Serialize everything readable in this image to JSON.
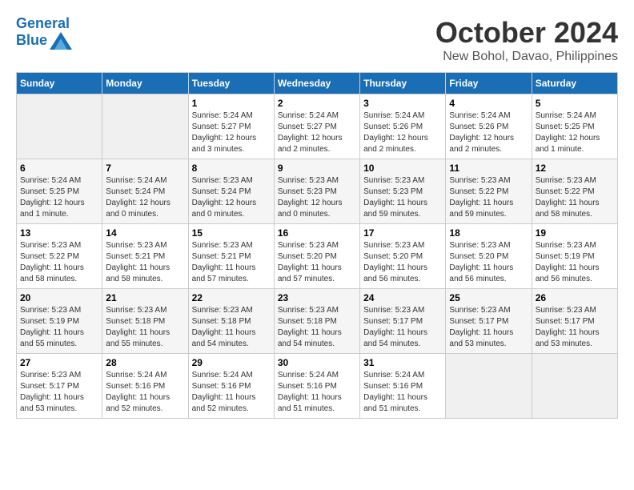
{
  "header": {
    "logo_line1": "General",
    "logo_line2": "Blue",
    "month": "October 2024",
    "location": "New Bohol, Davao, Philippines"
  },
  "weekdays": [
    "Sunday",
    "Monday",
    "Tuesday",
    "Wednesday",
    "Thursday",
    "Friday",
    "Saturday"
  ],
  "weeks": [
    [
      {
        "day": "",
        "info": ""
      },
      {
        "day": "",
        "info": ""
      },
      {
        "day": "1",
        "info": "Sunrise: 5:24 AM\nSunset: 5:27 PM\nDaylight: 12 hours\nand 3 minutes."
      },
      {
        "day": "2",
        "info": "Sunrise: 5:24 AM\nSunset: 5:27 PM\nDaylight: 12 hours\nand 2 minutes."
      },
      {
        "day": "3",
        "info": "Sunrise: 5:24 AM\nSunset: 5:26 PM\nDaylight: 12 hours\nand 2 minutes."
      },
      {
        "day": "4",
        "info": "Sunrise: 5:24 AM\nSunset: 5:26 PM\nDaylight: 12 hours\nand 2 minutes."
      },
      {
        "day": "5",
        "info": "Sunrise: 5:24 AM\nSunset: 5:25 PM\nDaylight: 12 hours\nand 1 minute."
      }
    ],
    [
      {
        "day": "6",
        "info": "Sunrise: 5:24 AM\nSunset: 5:25 PM\nDaylight: 12 hours\nand 1 minute."
      },
      {
        "day": "7",
        "info": "Sunrise: 5:24 AM\nSunset: 5:24 PM\nDaylight: 12 hours\nand 0 minutes."
      },
      {
        "day": "8",
        "info": "Sunrise: 5:23 AM\nSunset: 5:24 PM\nDaylight: 12 hours\nand 0 minutes."
      },
      {
        "day": "9",
        "info": "Sunrise: 5:23 AM\nSunset: 5:23 PM\nDaylight: 12 hours\nand 0 minutes."
      },
      {
        "day": "10",
        "info": "Sunrise: 5:23 AM\nSunset: 5:23 PM\nDaylight: 11 hours\nand 59 minutes."
      },
      {
        "day": "11",
        "info": "Sunrise: 5:23 AM\nSunset: 5:22 PM\nDaylight: 11 hours\nand 59 minutes."
      },
      {
        "day": "12",
        "info": "Sunrise: 5:23 AM\nSunset: 5:22 PM\nDaylight: 11 hours\nand 58 minutes."
      }
    ],
    [
      {
        "day": "13",
        "info": "Sunrise: 5:23 AM\nSunset: 5:22 PM\nDaylight: 11 hours\nand 58 minutes."
      },
      {
        "day": "14",
        "info": "Sunrise: 5:23 AM\nSunset: 5:21 PM\nDaylight: 11 hours\nand 58 minutes."
      },
      {
        "day": "15",
        "info": "Sunrise: 5:23 AM\nSunset: 5:21 PM\nDaylight: 11 hours\nand 57 minutes."
      },
      {
        "day": "16",
        "info": "Sunrise: 5:23 AM\nSunset: 5:20 PM\nDaylight: 11 hours\nand 57 minutes."
      },
      {
        "day": "17",
        "info": "Sunrise: 5:23 AM\nSunset: 5:20 PM\nDaylight: 11 hours\nand 56 minutes."
      },
      {
        "day": "18",
        "info": "Sunrise: 5:23 AM\nSunset: 5:20 PM\nDaylight: 11 hours\nand 56 minutes."
      },
      {
        "day": "19",
        "info": "Sunrise: 5:23 AM\nSunset: 5:19 PM\nDaylight: 11 hours\nand 56 minutes."
      }
    ],
    [
      {
        "day": "20",
        "info": "Sunrise: 5:23 AM\nSunset: 5:19 PM\nDaylight: 11 hours\nand 55 minutes."
      },
      {
        "day": "21",
        "info": "Sunrise: 5:23 AM\nSunset: 5:18 PM\nDaylight: 11 hours\nand 55 minutes."
      },
      {
        "day": "22",
        "info": "Sunrise: 5:23 AM\nSunset: 5:18 PM\nDaylight: 11 hours\nand 54 minutes."
      },
      {
        "day": "23",
        "info": "Sunrise: 5:23 AM\nSunset: 5:18 PM\nDaylight: 11 hours\nand 54 minutes."
      },
      {
        "day": "24",
        "info": "Sunrise: 5:23 AM\nSunset: 5:17 PM\nDaylight: 11 hours\nand 54 minutes."
      },
      {
        "day": "25",
        "info": "Sunrise: 5:23 AM\nSunset: 5:17 PM\nDaylight: 11 hours\nand 53 minutes."
      },
      {
        "day": "26",
        "info": "Sunrise: 5:23 AM\nSunset: 5:17 PM\nDaylight: 11 hours\nand 53 minutes."
      }
    ],
    [
      {
        "day": "27",
        "info": "Sunrise: 5:23 AM\nSunset: 5:17 PM\nDaylight: 11 hours\nand 53 minutes."
      },
      {
        "day": "28",
        "info": "Sunrise: 5:24 AM\nSunset: 5:16 PM\nDaylight: 11 hours\nand 52 minutes."
      },
      {
        "day": "29",
        "info": "Sunrise: 5:24 AM\nSunset: 5:16 PM\nDaylight: 11 hours\nand 52 minutes."
      },
      {
        "day": "30",
        "info": "Sunrise: 5:24 AM\nSunset: 5:16 PM\nDaylight: 11 hours\nand 51 minutes."
      },
      {
        "day": "31",
        "info": "Sunrise: 5:24 AM\nSunset: 5:16 PM\nDaylight: 11 hours\nand 51 minutes."
      },
      {
        "day": "",
        "info": ""
      },
      {
        "day": "",
        "info": ""
      }
    ]
  ]
}
